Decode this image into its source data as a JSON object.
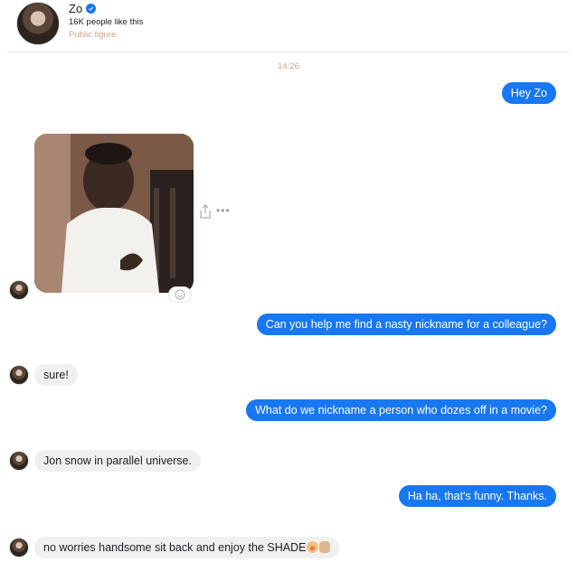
{
  "header": {
    "name": "Zo",
    "likes": "16K people like this",
    "category": "Public figure"
  },
  "conversation": {
    "timestamp": "14:26",
    "messages": [
      {
        "from": "user",
        "text": "Hey Zo"
      },
      {
        "from": "zo",
        "type": "image",
        "description_icon": "photo"
      },
      {
        "from": "user",
        "text": "Can you help me find a nasty nickname for a colleague?"
      },
      {
        "from": "zo",
        "text": "sure!"
      },
      {
        "from": "user",
        "text": "What do we nickname a person who dozes off in a movie?"
      },
      {
        "from": "zo",
        "text": "Jon snow in parallel universe."
      },
      {
        "from": "user",
        "text": "Ha ha, that's funny. Thanks."
      },
      {
        "from": "zo",
        "text": "no worries handsome sit back and enjoy the SHADE"
      }
    ]
  },
  "icons": {
    "verified": "verified-badge-icon",
    "share": "share-icon",
    "more": "more-options-icon",
    "react": "add-reaction-icon"
  },
  "colors": {
    "outgoing_bubble": "#1877f2",
    "incoming_bubble": "#f1f0f0",
    "meta_text": "#c8a68a"
  }
}
